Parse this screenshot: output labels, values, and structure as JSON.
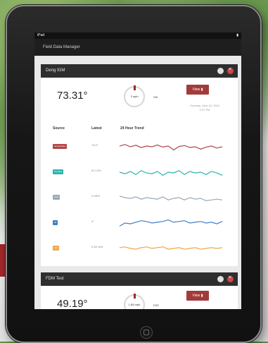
{
  "app": {
    "title": "Field Data Manager"
  },
  "status": {
    "carrier": "iPad",
    "wifi": "",
    "battery": ""
  },
  "panels": [
    {
      "name": "Deng IGM",
      "reading": "73.31°",
      "gauge_value": "3 mph",
      "gauge_dir": "SW",
      "view_label": "View",
      "date": "Tuesday, June 24, 2014",
      "time": "3:37 PM",
      "columns": {
        "source": "Source",
        "latest": "Latest",
        "trend": "24 Hour Trend"
      },
      "rows": [
        {
          "tag": "temperature",
          "latest": "75.5°",
          "color": "#b04646",
          "trend": [
            0.55,
            0.65,
            0.5,
            0.6,
            0.45,
            0.55,
            0.5,
            0.62,
            0.48,
            0.55,
            0.3,
            0.52,
            0.58,
            0.46,
            0.5,
            0.35,
            0.48,
            0.55,
            0.42,
            0.5
          ]
        },
        {
          "tag": "humidity",
          "latest": "61.13%",
          "color": "#2fb3ad",
          "trend": [
            0.5,
            0.4,
            0.55,
            0.35,
            0.6,
            0.45,
            0.4,
            0.55,
            0.3,
            0.5,
            0.45,
            0.6,
            0.35,
            0.55,
            0.45,
            0.5,
            0.35,
            0.55,
            0.45,
            0.3
          ]
        },
        {
          "tag": "wind",
          "latest": "3 MPH",
          "color": "#9aa8b5",
          "trend": [
            0.6,
            0.5,
            0.45,
            0.55,
            0.4,
            0.5,
            0.45,
            0.4,
            0.55,
            0.35,
            0.45,
            0.5,
            0.35,
            0.5,
            0.4,
            0.45,
            0.3,
            0.35,
            0.4,
            0.35
          ]
        },
        {
          "tag": "dir",
          "latest": "0°",
          "color": "#3f7fc6",
          "trend": [
            0.3,
            0.5,
            0.45,
            0.55,
            0.65,
            0.6,
            0.5,
            0.55,
            0.6,
            0.7,
            0.55,
            0.6,
            0.65,
            0.5,
            0.55,
            0.6,
            0.5,
            0.55,
            0.45,
            0.6
          ]
        },
        {
          "tag": "rain",
          "latest": "0.48 in/hr",
          "color": "#f0a84a",
          "trend": [
            0.55,
            0.6,
            0.5,
            0.45,
            0.55,
            0.6,
            0.5,
            0.55,
            0.6,
            0.45,
            0.5,
            0.55,
            0.45,
            0.5,
            0.55,
            0.45,
            0.5,
            0.55,
            0.5,
            0.55
          ]
        }
      ]
    },
    {
      "name": "FDM Test",
      "reading": "49.19°",
      "gauge_value": "1.85 mph",
      "gauge_dir": "ESE",
      "view_label": "View"
    }
  ]
}
